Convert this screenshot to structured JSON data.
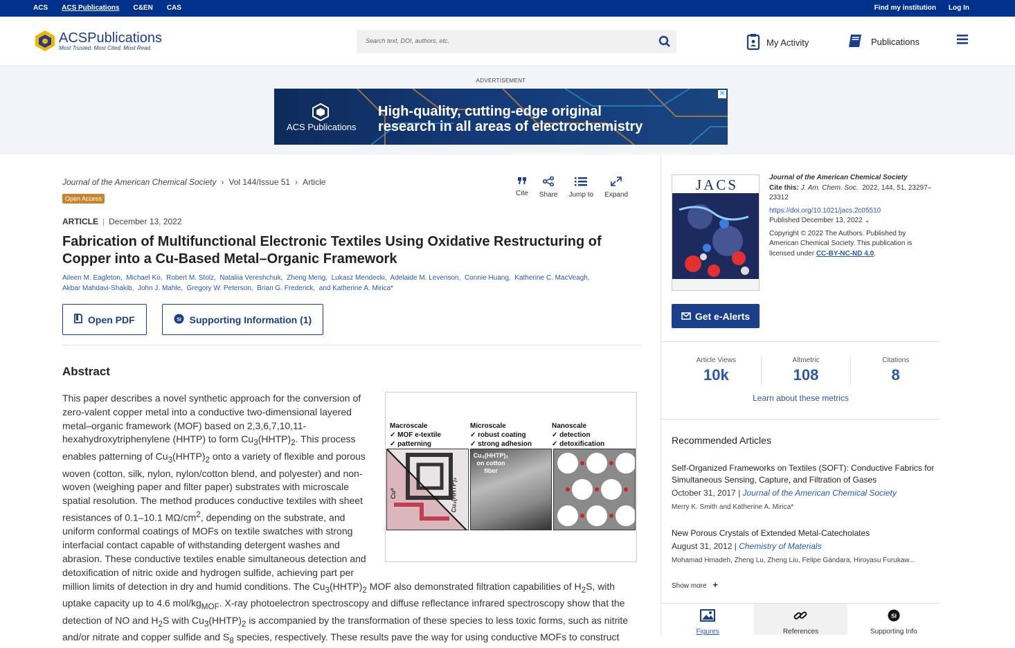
{
  "topbar": {
    "left": [
      "ACS",
      "ACS Publications",
      "C&EN",
      "CAS"
    ],
    "right": [
      "Find my institution",
      "Log In"
    ]
  },
  "header": {
    "logo_main": "ACS",
    "logo_bold": "Publications",
    "tagline": "Most Trusted. Most Cited. Most Read.",
    "search_placeholder": "Search text, DOI, authors, etc.",
    "my_activity": "My Activity",
    "publications": "Publications"
  },
  "ad": {
    "label": "ADVERTISEMENT",
    "brand": "ACS Publications",
    "headline1": "High-quality, cutting-edge original",
    "headline2": "research in all areas of electrochemistry",
    "close": "✕"
  },
  "article": {
    "journal": "Journal of the American Chemical Society",
    "volume": "Vol 144/Issue 51",
    "type_crumb": "Article",
    "badge": "Open Access",
    "type": "ARTICLE",
    "date": "December 13, 2022",
    "title": "Fabrication of Multifunctional Electronic Textiles Using Oxidative Restructuring of Copper into a Cu-Based Metal–Organic Framework",
    "authors": [
      "Aileen M. Eagleton,",
      "Michael Ko,",
      "Robert M. Stolz,",
      "Nataliia Vereshchuk,",
      "Zheng Meng,",
      "Lukasz Mendecki,",
      "Adelaide M. Levenson,",
      "Connie Huang,",
      "Katherine C. MacVeagh,",
      "Akbar Mahdavi-Shakib,",
      "John J. Mahle,",
      "Gregory W. Peterson,",
      "Brian G. Frederick,",
      "and Katherine A. Mirica*"
    ],
    "tools": [
      "Cite",
      "Share",
      "Jump to",
      "Expand"
    ],
    "open_pdf": "Open PDF",
    "supporting": "Supporting Information (1)",
    "abstract_heading": "Abstract"
  },
  "toc": {
    "col1": [
      "Macroscale",
      "✓ MOF e-textile",
      "✓ patterning"
    ],
    "col2": [
      "Microscale",
      "✓ robust coating",
      "✓ strong adhesion"
    ],
    "col3": [
      "Nanoscale",
      "✓ detection",
      "✓ detoxification"
    ],
    "label_a": "Cu⁰",
    "label_b": "Cu₃(HHTP)₂",
    "label_c": "Cu₃(HHTP)₂",
    "label_c2": "on cotton",
    "label_c3": "fiber"
  },
  "sidebar": {
    "journal": "Journal of the American Chemical Society",
    "cite_label": "Cite this:",
    "cite_journal": "J. Am. Chem. Soc.",
    "cite_rest": "2022, 144, 51, 23297–23312",
    "doi": "https://doi.org/10.1021/jacs.2c05510",
    "published": "Published December 13, 2022",
    "copyright": "Copyright © 2022 The Authors. Published by American Chemical Society. This publication is licensed under",
    "license": "CC-BY-NC-ND 4.0",
    "license_end": ".",
    "alerts": "Get e-Alerts",
    "metrics": [
      {
        "label": "Article Views",
        "value": "10k"
      },
      {
        "label": "Altmetric",
        "value": "108"
      },
      {
        "label": "Citations",
        "value": "8"
      }
    ],
    "learn": "Learn about these metrics",
    "rec_heading": "Recommended Articles",
    "recs": [
      {
        "title": "Self-Organized Frameworks on Textiles (SOFT): Conductive Fabrics for Simultaneous Sensing, Capture, and Filtration of Gases",
        "date": "October 31, 2017 |",
        "journal": "Journal of the American Chemical Society",
        "authors": "Merry K. Smith and Katherine A. Mirica*"
      },
      {
        "title": "New Porous Crystals of Extended Metal-Catecholates",
        "date": "August 31, 2012 |",
        "journal": "Chemistry of Materials",
        "authors": "Mohamad Hmadeh, Zheng Lu, Zheng Liu, Felipe Gándara, Hiroyasu Furukaw..."
      }
    ],
    "show_more": "Show more",
    "tabs": [
      "Figures",
      "References",
      "Supporting Info"
    ],
    "cover_title": "JACS"
  },
  "colors": {
    "brand": "#00318b",
    "link": "#2859a8",
    "badge": "#c9832c"
  }
}
